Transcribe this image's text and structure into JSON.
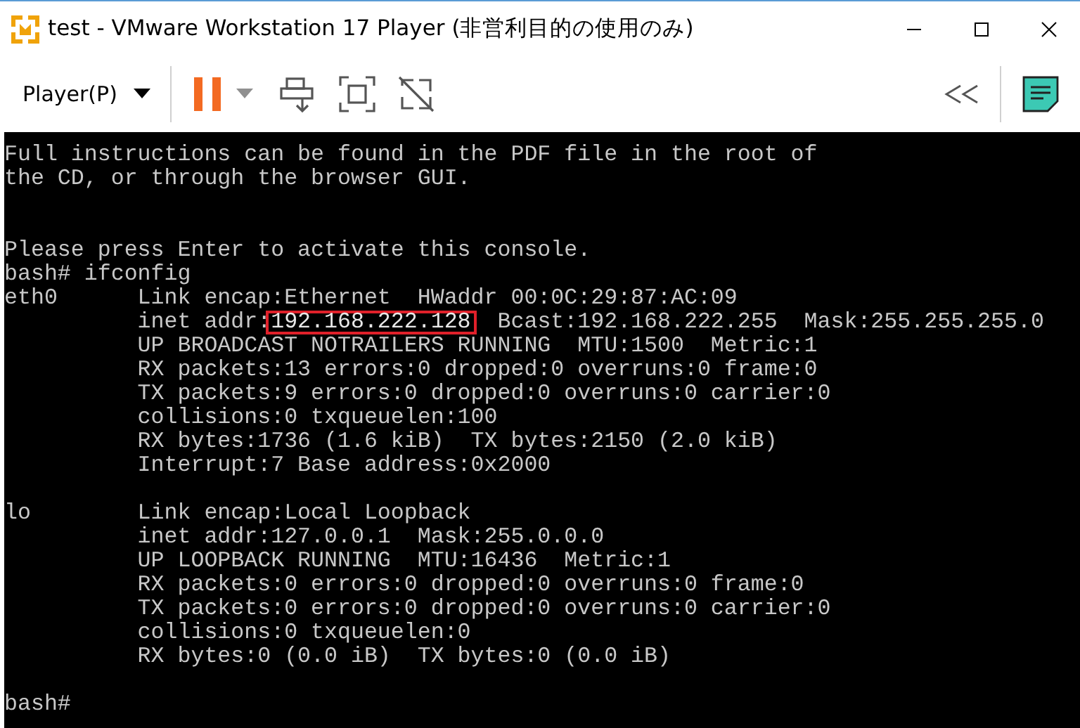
{
  "window": {
    "title": "test - VMware Workstation 17 Player (非営利目的の使用のみ)"
  },
  "toolbar": {
    "menu_label": "Player(P)"
  },
  "console": {
    "lines": [
      {
        "kind": "text",
        "text": "Full instructions can be found in the PDF file in the root of"
      },
      {
        "kind": "text",
        "text": "the CD, or through the browser GUI."
      },
      {
        "kind": "blank"
      },
      {
        "kind": "blank"
      },
      {
        "kind": "text",
        "text": "Please press Enter to activate this console."
      },
      {
        "kind": "text",
        "text": "bash# ifconfig"
      },
      {
        "kind": "text",
        "text": "eth0      Link encap:Ethernet  HWaddr 00:0C:29:87:AC:09"
      },
      {
        "kind": "highlighted",
        "before": "          inet addr:",
        "highlight": "192.168.222.128",
        "after": "  Bcast:192.168.222.255  Mask:255.255.255.0"
      },
      {
        "kind": "text",
        "text": "          UP BROADCAST NOTRAILERS RUNNING  MTU:1500  Metric:1"
      },
      {
        "kind": "text",
        "text": "          RX packets:13 errors:0 dropped:0 overruns:0 frame:0"
      },
      {
        "kind": "text",
        "text": "          TX packets:9 errors:0 dropped:0 overruns:0 carrier:0"
      },
      {
        "kind": "text",
        "text": "          collisions:0 txqueuelen:100"
      },
      {
        "kind": "text",
        "text": "          RX bytes:1736 (1.6 kiB)  TX bytes:2150 (2.0 kiB)"
      },
      {
        "kind": "text",
        "text": "          Interrupt:7 Base address:0x2000"
      },
      {
        "kind": "blank"
      },
      {
        "kind": "text",
        "text": "lo        Link encap:Local Loopback"
      },
      {
        "kind": "text",
        "text": "          inet addr:127.0.0.1  Mask:255.0.0.0"
      },
      {
        "kind": "text",
        "text": "          UP LOOPBACK RUNNING  MTU:16436  Metric:1"
      },
      {
        "kind": "text",
        "text": "          RX packets:0 errors:0 dropped:0 overruns:0 frame:0"
      },
      {
        "kind": "text",
        "text": "          TX packets:0 errors:0 dropped:0 overruns:0 carrier:0"
      },
      {
        "kind": "text",
        "text": "          collisions:0 txqueuelen:0"
      },
      {
        "kind": "text",
        "text": "          RX bytes:0 (0.0 iB)  TX bytes:0 (0.0 iB)"
      },
      {
        "kind": "blank"
      },
      {
        "kind": "text",
        "text": "bash#"
      }
    ]
  }
}
